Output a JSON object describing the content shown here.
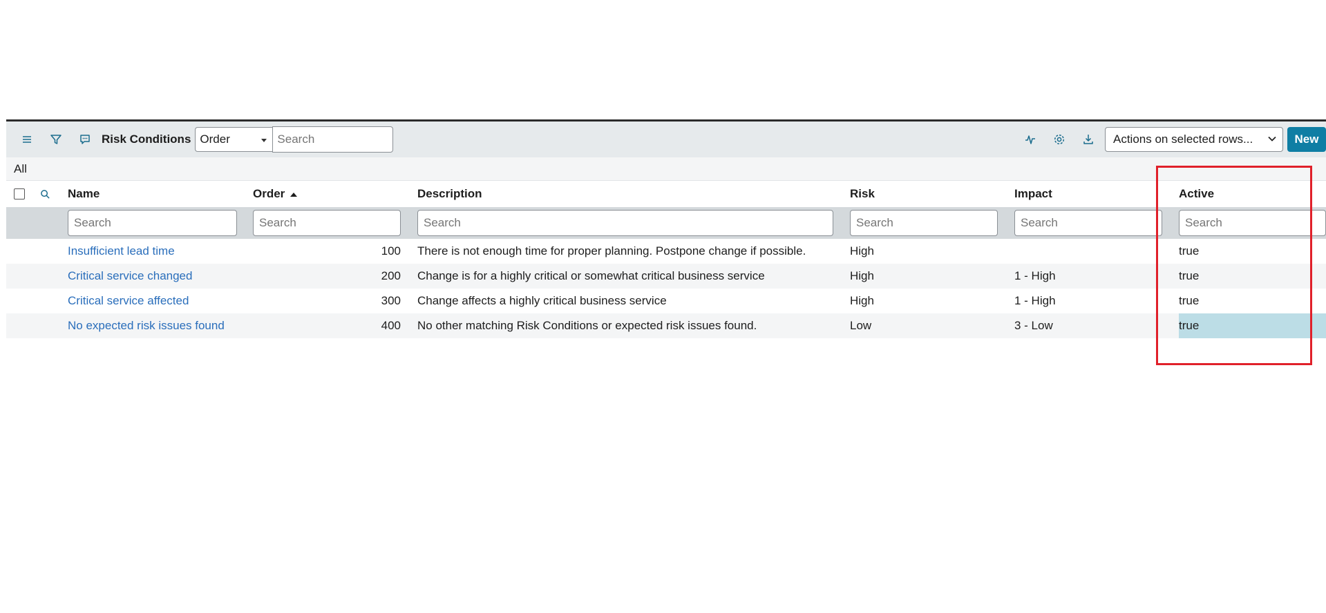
{
  "toolbar": {
    "title": "Risk Conditions",
    "order_select": "Order",
    "search_placeholder": "Search",
    "actions_select": "Actions on selected rows...",
    "new_label": "New"
  },
  "breadcrumb": "All",
  "columns": [
    "Name",
    "Order",
    "Description",
    "Risk",
    "Impact",
    "Active"
  ],
  "column_search_placeholder": "Search",
  "rows": [
    {
      "name": "Insufficient lead time",
      "order": "100",
      "description": "There is not enough time for proper planning. Postpone change if possible.",
      "risk": "High",
      "impact": "",
      "active": "true"
    },
    {
      "name": "Critical service changed",
      "order": "200",
      "description": "Change is for a highly critical or somewhat critical business service",
      "risk": "High",
      "impact": "1 - High",
      "active": "true"
    },
    {
      "name": "Critical service affected",
      "order": "300",
      "description": "Change affects a highly critical business service",
      "risk": "High",
      "impact": "1 - High",
      "active": "true"
    },
    {
      "name": "No expected risk issues found",
      "order": "400",
      "description": "No other matching Risk Conditions or expected risk issues found.",
      "risk": "Low",
      "impact": "3 - Low",
      "active": "true"
    }
  ],
  "colors": {
    "accent": "#0f7ea4",
    "link": "#2a6ebb",
    "highlight": "#bcdde6",
    "annotation": "#e0202a"
  }
}
